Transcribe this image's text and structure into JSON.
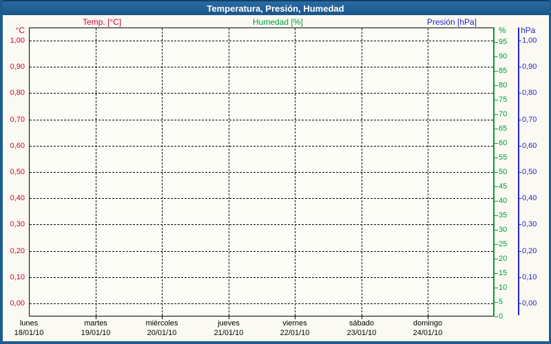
{
  "header": {
    "title": "Temperatura, Presión, Humedad"
  },
  "legend": {
    "temperature": "Temp. [°C]",
    "humidity": "Humedad [%]",
    "pressure": "Presión [hPa]"
  },
  "colors": {
    "temperature": "#d10033",
    "humidity": "#009a40",
    "pressure": "#2222c8",
    "header_bg": "#1e5c90",
    "grid": "#000000"
  },
  "axes": {
    "temperature": {
      "unit": "°C",
      "side": "left",
      "ticks": [
        {
          "label": "1,00",
          "value": 1.0
        },
        {
          "label": "0,90",
          "value": 0.9
        },
        {
          "label": "0,80",
          "value": 0.8
        },
        {
          "label": "0,70",
          "value": 0.7
        },
        {
          "label": "0,60",
          "value": 0.6
        },
        {
          "label": "0,50",
          "value": 0.5
        },
        {
          "label": "0,40",
          "value": 0.4
        },
        {
          "label": "0,30",
          "value": 0.3
        },
        {
          "label": "0,20",
          "value": 0.2
        },
        {
          "label": "0,10",
          "value": 0.1
        },
        {
          "label": "0,00",
          "value": 0.0
        }
      ]
    },
    "humidity": {
      "unit": "%",
      "side": "right-inner",
      "ticks": [
        {
          "label": "95",
          "value": 95
        },
        {
          "label": "90",
          "value": 90
        },
        {
          "label": "85",
          "value": 85
        },
        {
          "label": "80",
          "value": 80
        },
        {
          "label": "75",
          "value": 75
        },
        {
          "label": "70",
          "value": 70
        },
        {
          "label": "65",
          "value": 65
        },
        {
          "label": "60",
          "value": 60
        },
        {
          "label": "55",
          "value": 55
        },
        {
          "label": "50",
          "value": 50
        },
        {
          "label": "45",
          "value": 45
        },
        {
          "label": "40",
          "value": 40
        },
        {
          "label": "35",
          "value": 35
        },
        {
          "label": "30",
          "value": 30
        },
        {
          "label": "25",
          "value": 25
        },
        {
          "label": "20",
          "value": 20
        },
        {
          "label": "15",
          "value": 15
        },
        {
          "label": "10",
          "value": 10
        },
        {
          "label": "5",
          "value": 5
        },
        {
          "label": "0",
          "value": 0
        }
      ]
    },
    "pressure": {
      "unit": "hPa",
      "side": "right-outer",
      "ticks": [
        {
          "label": "1,00",
          "value": 1.0
        },
        {
          "label": "0,90",
          "value": 0.9
        },
        {
          "label": "0,80",
          "value": 0.8
        },
        {
          "label": "0,70",
          "value": 0.7
        },
        {
          "label": "0,60",
          "value": 0.6
        },
        {
          "label": "0,50",
          "value": 0.5
        },
        {
          "label": "0,40",
          "value": 0.4
        },
        {
          "label": "0,30",
          "value": 0.3
        },
        {
          "label": "0,20",
          "value": 0.2
        },
        {
          "label": "0,10",
          "value": 0.1
        },
        {
          "label": "0,00",
          "value": 0.0
        }
      ]
    },
    "x": {
      "days": [
        {
          "name": "lunes",
          "date": "18/01/10"
        },
        {
          "name": "martes",
          "date": "19/01/10"
        },
        {
          "name": "miércoles",
          "date": "20/01/10"
        },
        {
          "name": "jueves",
          "date": "21/01/10"
        },
        {
          "name": "viernes",
          "date": "22/01/10"
        },
        {
          "name": "sábado",
          "date": "23/01/10"
        },
        {
          "name": "domingo",
          "date": "24/01/10"
        }
      ]
    }
  },
  "chart_data": {
    "type": "line",
    "title": "Temperatura, Presión, Humedad",
    "x": {
      "categories": [
        "lunes 18/01/10",
        "martes 19/01/10",
        "miércoles 20/01/10",
        "jueves 21/01/10",
        "viernes 22/01/10",
        "sábado 23/01/10",
        "domingo 24/01/10"
      ]
    },
    "grid": true,
    "series": [
      {
        "name": "Temp. [°C]",
        "axis": "left",
        "color": "#d10033",
        "ylim": [
          0.0,
          1.0
        ],
        "tick_step": 0.1,
        "values": []
      },
      {
        "name": "Humedad [%]",
        "axis": "right-inner",
        "color": "#009a40",
        "ylim": [
          0,
          100
        ],
        "tick_step": 5,
        "values": []
      },
      {
        "name": "Presión [hPa]",
        "axis": "right-outer",
        "color": "#2222c8",
        "ylim": [
          0.0,
          1.0
        ],
        "tick_step": 0.1,
        "values": []
      }
    ]
  }
}
